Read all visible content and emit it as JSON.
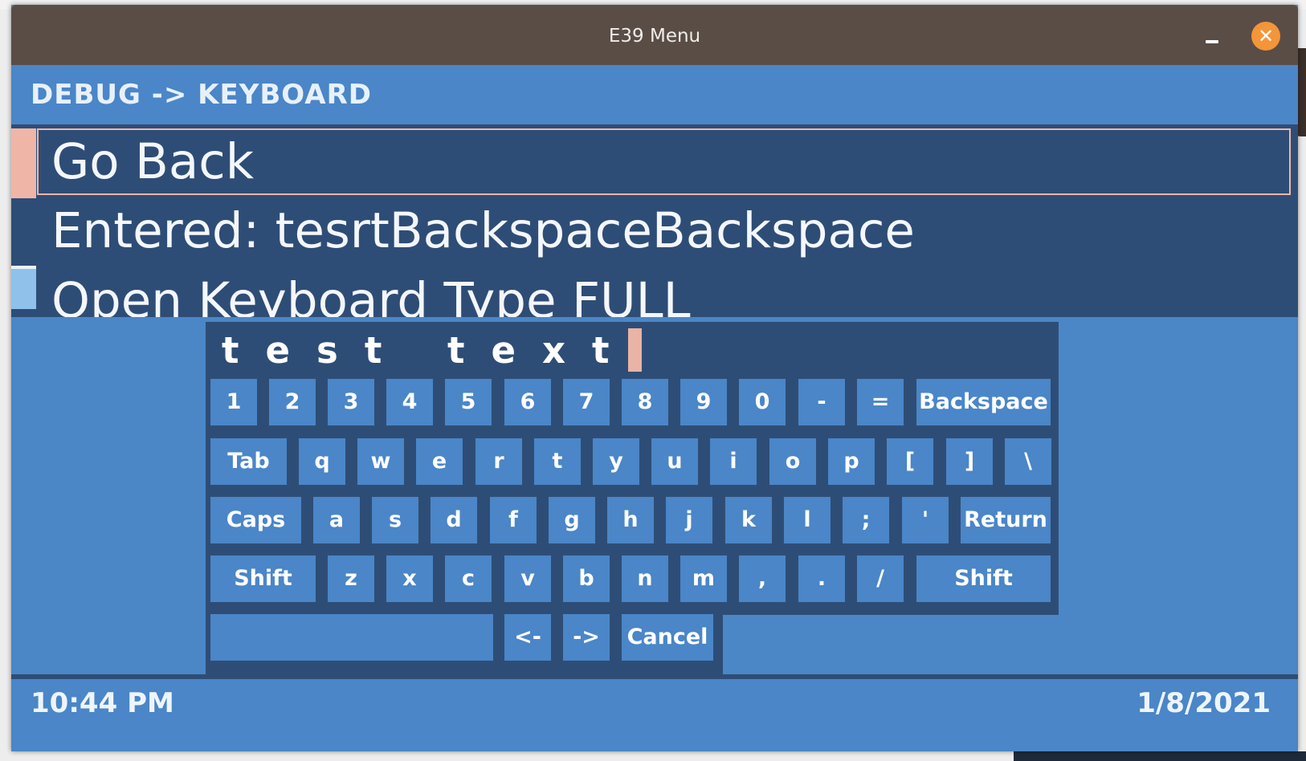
{
  "window": {
    "title": "E39 Menu"
  },
  "header": {
    "breadcrumb": "DEBUG -> KEYBOARD"
  },
  "menu": {
    "items": [
      {
        "label": "Go Back"
      },
      {
        "label": "Entered: tesrtBackspaceBackspace"
      },
      {
        "label": "Open Keyboard Type FULL"
      }
    ]
  },
  "keyboard": {
    "input_value": "test text",
    "rows": [
      [
        "1",
        "2",
        "3",
        "4",
        "5",
        "6",
        "7",
        "8",
        "9",
        "0",
        "-",
        "=",
        "Backspace"
      ],
      [
        "Tab",
        "q",
        "w",
        "e",
        "r",
        "t",
        "y",
        "u",
        "i",
        "o",
        "p",
        "[",
        "]",
        "\\"
      ],
      [
        "Caps",
        "a",
        "s",
        "d",
        "f",
        "g",
        "h",
        "j",
        "k",
        "l",
        ";",
        "'",
        "Return"
      ],
      [
        "Shift",
        "z",
        "x",
        "c",
        "v",
        "b",
        "n",
        "m",
        ",",
        ".",
        "/",
        "Shift"
      ],
      [
        "",
        "<-",
        "->",
        "Cancel"
      ]
    ]
  },
  "footer": {
    "time": "10:44 PM",
    "date": "1/8/2021"
  },
  "colors": {
    "titlebar": "#5a4d46",
    "accent_blue": "#4a86c8",
    "dark_blue": "#2e4d76",
    "selection": "#efb6a8",
    "close_orange": "#f39538"
  }
}
